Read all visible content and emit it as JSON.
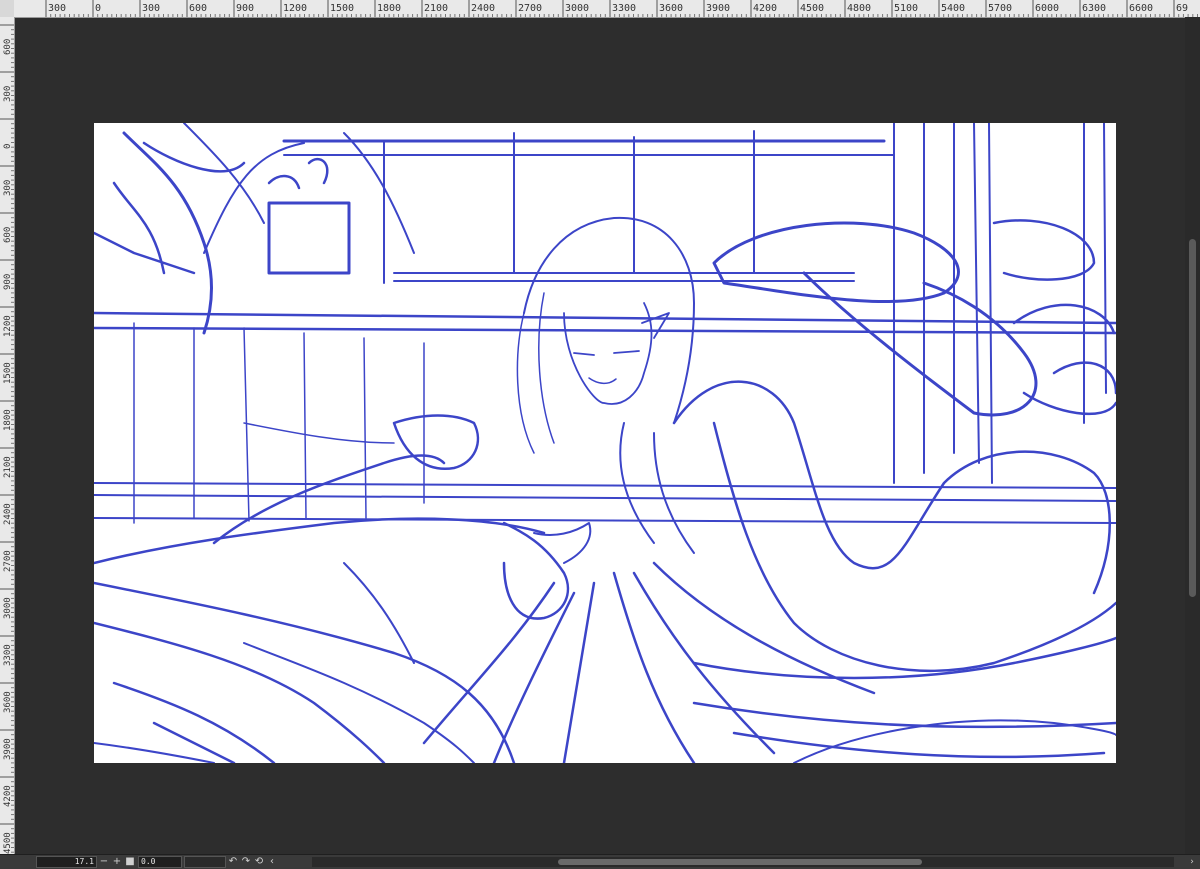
{
  "ruler_top": {
    "labels": [
      "300",
      "0",
      "300",
      "600",
      "900",
      "1200",
      "1500",
      "1800",
      "2100",
      "2400",
      "2700",
      "3000",
      "3300",
      "3600",
      "3900",
      "4200",
      "4500",
      "4800",
      "5100",
      "5400",
      "5700",
      "6000",
      "6300",
      "6600",
      "69"
    ]
  },
  "ruler_left": {
    "labels": [
      "600",
      "300",
      "0",
      "300",
      "600",
      "900",
      "1200",
      "1500",
      "1800",
      "2100",
      "2400",
      "2700",
      "3000",
      "3300",
      "3600",
      "3900",
      "4200",
      "4500"
    ]
  },
  "statusbar": {
    "zoom_value": "17.1",
    "zoom_out_label": "−",
    "zoom_in_label": "+",
    "rotation_value": "0.0",
    "fit_icon": "square-icon",
    "rotate_left_icon": "rotate-left-icon",
    "rotate_right_icon": "rotate-right-icon",
    "reset_rotation_icon": "reset-rotation-icon",
    "scroll_left_icon": "chevron-left-icon",
    "scroll_right_icon": "chevron-right-icon"
  },
  "canvas": {
    "stroke_color": "#3c45c8",
    "background": "#ffffff"
  },
  "colors": {
    "workspace": "#2d2d2d",
    "ruler": "#e9e9e9"
  }
}
